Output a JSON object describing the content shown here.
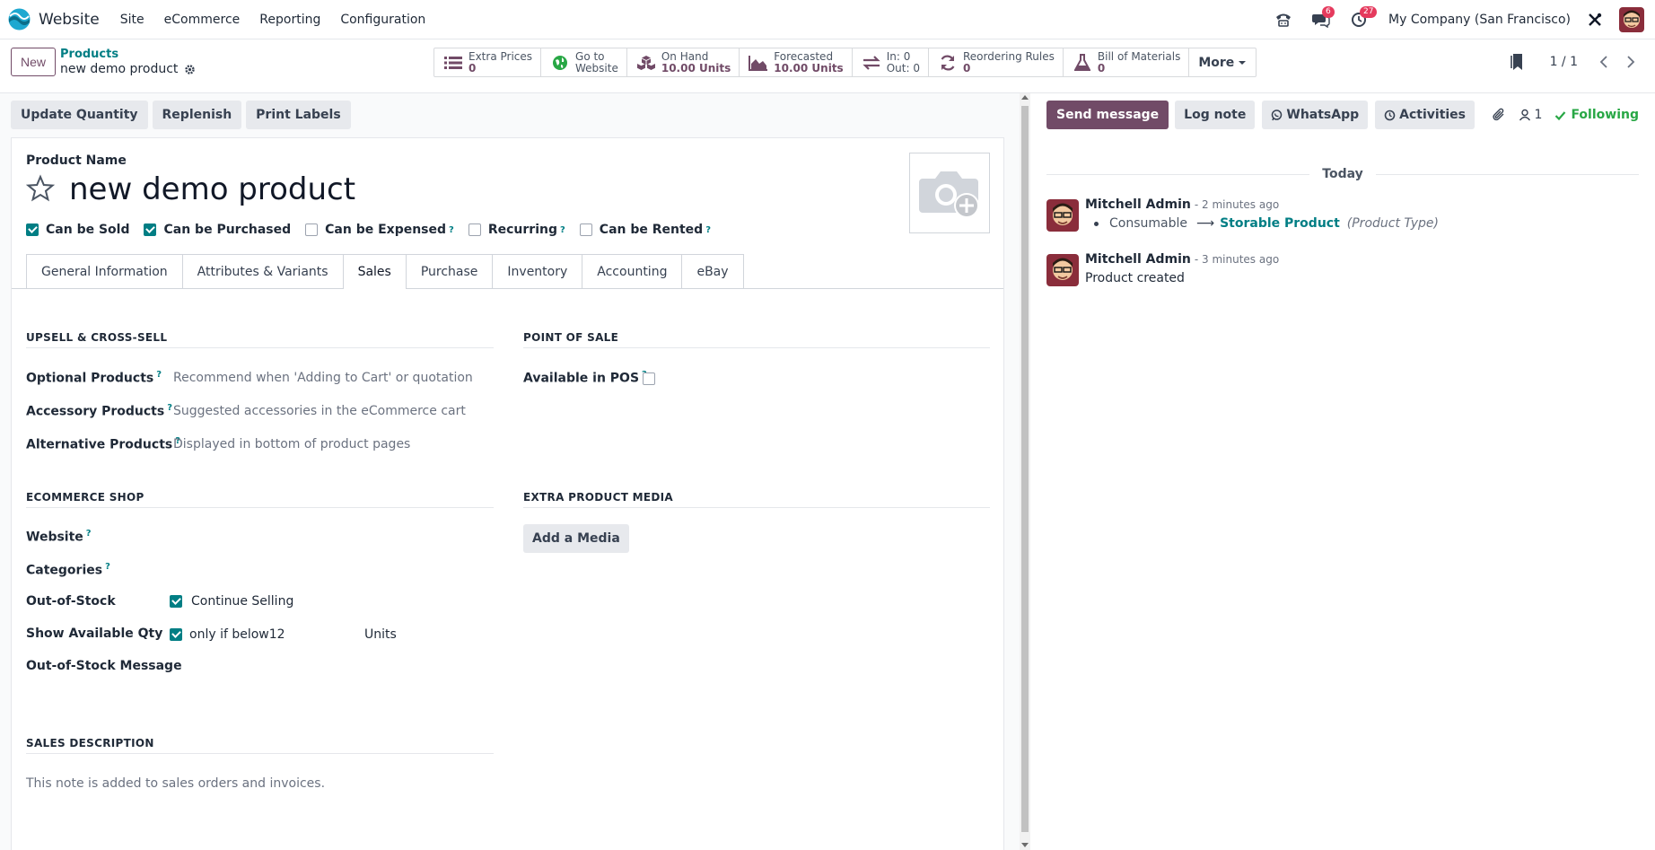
{
  "navbar": {
    "app_name": "Website",
    "menu": [
      "Site",
      "eCommerce",
      "Reporting",
      "Configuration"
    ],
    "messages_count": "6",
    "activities_count": "27",
    "company": "My Company (San Francisco)"
  },
  "control_panel": {
    "new_label": "New",
    "breadcrumb_parent": "Products",
    "breadcrumb_current": "new demo product",
    "smart_buttons": [
      {
        "icon": "list-icon",
        "label": "Extra Prices",
        "value": "0"
      },
      {
        "icon": "globe-icon",
        "label": "Go to",
        "value": "Website"
      },
      {
        "icon": "cubes-icon",
        "label": "On Hand",
        "value": "10.00 Units"
      },
      {
        "icon": "area-chart-icon",
        "label": "Forecasted",
        "value": "10.00 Units"
      },
      {
        "icon": "exchange-icon",
        "label": "In: 0",
        "value": "Out: 0"
      },
      {
        "icon": "refresh-icon",
        "label": "Reordering Rules",
        "value": "0"
      },
      {
        "icon": "flask-icon",
        "label": "Bill of Materials",
        "value": "0"
      }
    ],
    "more_label": "More",
    "pager": "1 / 1"
  },
  "statusbar": {
    "buttons": [
      "Update Quantity",
      "Replenish",
      "Print Labels"
    ]
  },
  "form": {
    "product_name_label": "Product Name",
    "product_name": "new demo product",
    "checkboxes": [
      {
        "label": "Can be Sold",
        "checked": true,
        "help": false
      },
      {
        "label": "Can be Purchased",
        "checked": true,
        "help": false
      },
      {
        "label": "Can be Expensed",
        "checked": false,
        "help": true
      },
      {
        "label": "Recurring",
        "checked": false,
        "help": true
      },
      {
        "label": "Can be Rented",
        "checked": false,
        "help": true
      }
    ],
    "tabs": [
      "General Information",
      "Attributes & Variants",
      "Sales",
      "Purchase",
      "Inventory",
      "Accounting",
      "eBay"
    ],
    "active_tab": "Sales",
    "upsell": {
      "title": "UPSELL & CROSS-SELL",
      "optional_label": "Optional Products",
      "optional_placeholder": "Recommend when 'Adding to Cart' or quotation",
      "accessory_label": "Accessory Products",
      "accessory_placeholder": "Suggested accessories in the eCommerce cart",
      "alternative_label": "Alternative Products",
      "alternative_placeholder": "Displayed in bottom of product pages"
    },
    "pos": {
      "title": "POINT OF SALE",
      "available_label": "Available in POS",
      "available_checked": false
    },
    "ecommerce": {
      "title": "ECOMMERCE SHOP",
      "website_label": "Website",
      "categories_label": "Categories",
      "out_of_stock_label": "Out-of-Stock",
      "continue_selling": "Continue Selling",
      "show_qty_label": "Show Available Qty",
      "only_if_below": "only if below",
      "threshold": "12",
      "units": "Units",
      "oos_message_label": "Out-of-Stock Message"
    },
    "media": {
      "title": "EXTRA PRODUCT MEDIA",
      "add_label": "Add a Media"
    },
    "sales_description": {
      "title": "SALES DESCRIPTION",
      "placeholder": "This note is added to sales orders and invoices."
    }
  },
  "chatter": {
    "send_message": "Send message",
    "log_note": "Log note",
    "whatsapp": "WhatsApp",
    "activities": "Activities",
    "followers": "1",
    "following": "Following",
    "day_label": "Today",
    "messages": [
      {
        "author": "Mitchell Admin",
        "date": "- 2 minutes ago",
        "old_value": "Consumable",
        "new_value": "Storable Product",
        "field": "(Product Type)"
      },
      {
        "author": "Mitchell Admin",
        "date": "- 3 minutes ago",
        "body": "Product created"
      }
    ]
  },
  "colors": {
    "brand": "#714b67",
    "accent": "#017e84",
    "badge": "#e53a5d",
    "following": "#28a745"
  }
}
